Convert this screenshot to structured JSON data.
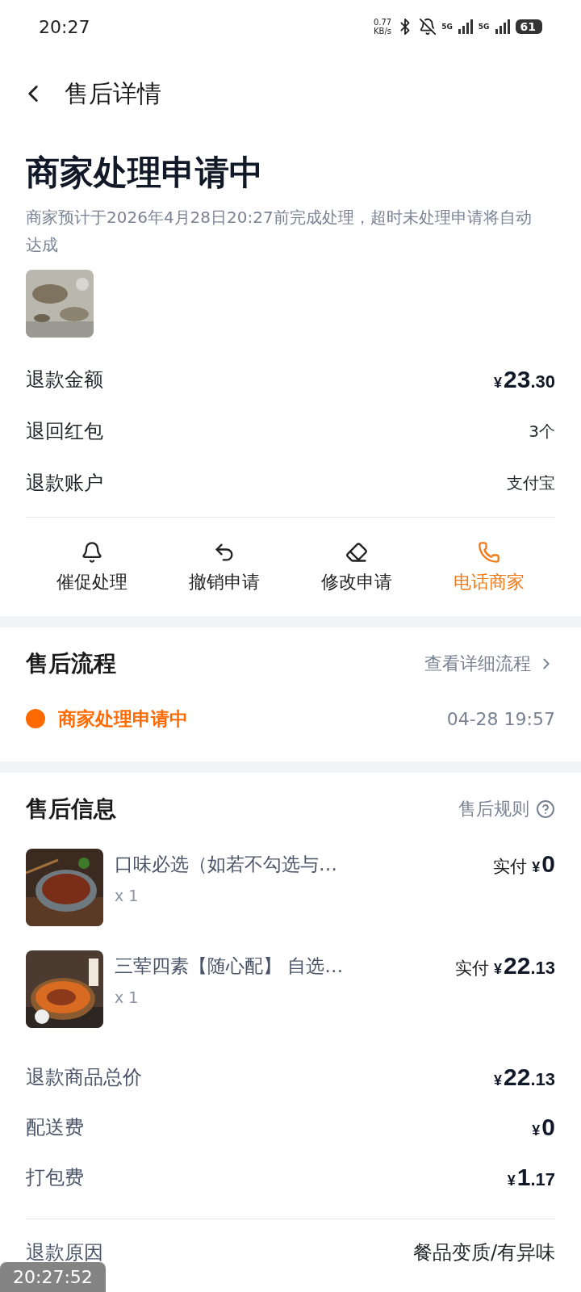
{
  "status_bar": {
    "time": "20:27",
    "net_speed_value": "0.77",
    "net_speed_unit": "KB/s",
    "network_1": "5G",
    "network_2": "5G",
    "battery": "61"
  },
  "header": {
    "title": "售后详情"
  },
  "status": {
    "title": "商家处理申请中",
    "description": "商家预计于2026年4月28日20:27前完成处理，超时未处理申请将自动达成"
  },
  "summary": [
    {
      "label": "退款金额",
      "kind": "money",
      "symbol": "¥",
      "integer": "23",
      "decimal": ".30"
    },
    {
      "label": "退回红包",
      "kind": "text",
      "value": "3个"
    },
    {
      "label": "退款账户",
      "kind": "text",
      "value": "支付宝"
    }
  ],
  "actions": [
    {
      "label": "催促处理",
      "highlight": false
    },
    {
      "label": "撤销申请",
      "highlight": false
    },
    {
      "label": "修改申请",
      "highlight": false
    },
    {
      "label": "电话商家",
      "highlight": true
    }
  ],
  "flow": {
    "title": "售后流程",
    "link": "查看详细流程",
    "steps": [
      {
        "label": "商家处理申请中",
        "time": "04-28 19:57",
        "color": "#ff6a00"
      }
    ]
  },
  "info": {
    "title": "售后信息",
    "rules_link": "售后规则",
    "items": [
      {
        "name": "口味必选（如若不勾选与…",
        "qty": "x 1",
        "paid_label": "实付",
        "symbol": "¥",
        "integer": "0",
        "kind": "picture"
      },
      {
        "name": "三荤四素【随心配】 自选…",
        "qty": "x 1",
        "paid_label": "实付",
        "symbol": "¥",
        "integer": "22",
        "decimal": ".13",
        "kind": "picture"
      }
    ],
    "fees": [
      {
        "label": "退款商品总价",
        "symbol": "¥",
        "integer": "22",
        "decimal": ".13"
      },
      {
        "label": "配送费",
        "symbol": "¥",
        "integer": "0"
      },
      {
        "label": "打包费",
        "symbol": "¥",
        "integer": "1",
        "decimal": ".17"
      }
    ],
    "reason": {
      "label": "退款原因",
      "value": "餐品变质/有异味"
    }
  },
  "recorder_overlay": {
    "time": "20:27:52"
  }
}
